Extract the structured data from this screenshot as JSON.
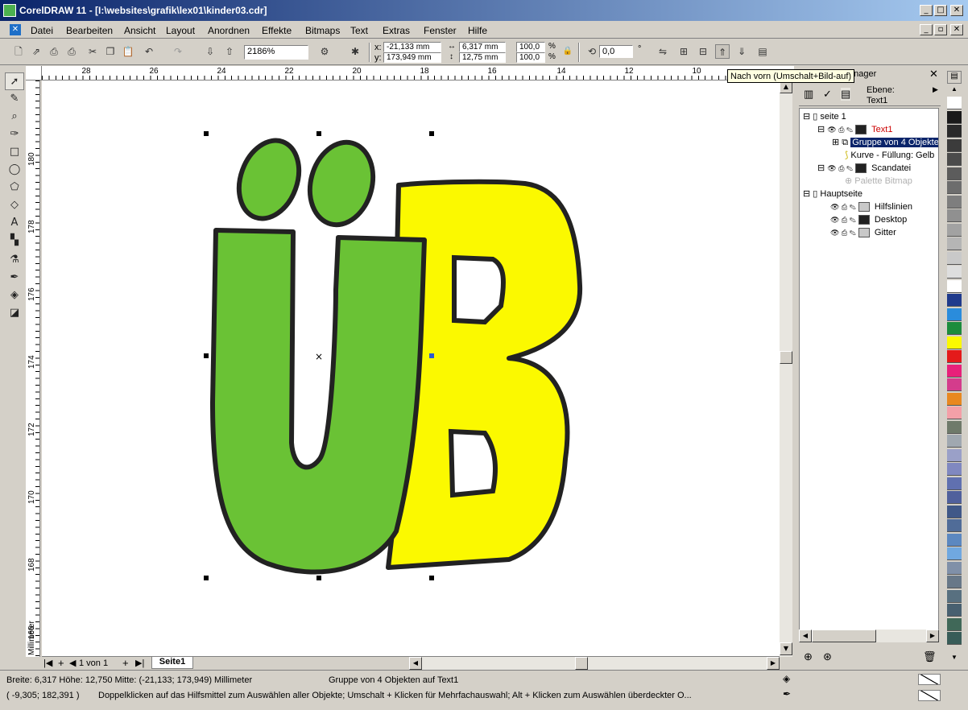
{
  "window": {
    "title": "CorelDRAW 11 - [I:\\websites\\grafik\\lex01\\kinder03.cdr]",
    "controls": [
      "_",
      "□",
      "✕"
    ],
    "doc_controls": [
      "_",
      "▫",
      "✕"
    ]
  },
  "menu": [
    "Datei",
    "Bearbeiten",
    "Ansicht",
    "Layout",
    "Anordnen",
    "Effekte",
    "Bitmaps",
    "Text",
    "Extras",
    "Fenster",
    "Hilfe"
  ],
  "toolbar": {
    "zoom": "2186%",
    "x_label": "x:",
    "y_label": "y:",
    "x_value": "-21,133 mm",
    "y_value": "173,949 mm",
    "width_value": "6,317 mm",
    "height_value": "12,75 mm",
    "scale_x": "100,0",
    "scale_y": "100,0",
    "percent": "%",
    "rotation": "0,0",
    "degree": "°"
  },
  "tooltip": "Nach vorn (Umschalt+Bild-auf)",
  "rulers": {
    "h_labels": [
      "28",
      "26",
      "24",
      "22",
      "20",
      "18",
      "16",
      "14",
      "12",
      "10"
    ],
    "v_labels": [
      "180",
      "178",
      "176",
      "174",
      "172",
      "170",
      "168",
      "166"
    ],
    "v_unit": "Millimeter"
  },
  "page_nav": {
    "count": "1 von 1",
    "tab": "Seite1"
  },
  "object_manager": {
    "title_tail": "anager",
    "layer_label": "Ebene:",
    "layer_value": "Text1",
    "tree": {
      "page1": "seite 1",
      "text1": "Text1",
      "group": "Gruppe von 4 Objekten",
      "curve": "Kurve - Füllung: Gelb",
      "scan": "Scandatei",
      "palette_bitmap": "Palette Bitmap",
      "master": "Hauptseite",
      "guides": "Hilfslinien",
      "desktop": "Desktop",
      "grid": "Gitter"
    },
    "colors": {
      "text1": "#cc0000",
      "selected_bg": "#0a246a"
    }
  },
  "status": {
    "dimensions": "Breite: 6,317  Höhe: 12,750  Mitte: (-21,133; 173,949) Millimeter",
    "selection": "Gruppe von 4 Objekten auf Text1",
    "cursor": "( -9,305; 182,391 )",
    "hint": "Doppelklicken auf das Hilfsmittel zum Auswählen aller Objekte; Umschalt + Klicken für Mehrfachauswahl; Alt + Klicken zum Auswählen überdeckter O..."
  },
  "artwork": {
    "green": "#6ac235",
    "yellow": "#fbf900",
    "outline": "#222222",
    "handle_center": "#2c5ccf"
  },
  "palette_colors": [
    "#ffffff",
    "#1a1a1a",
    "#2a2a2a",
    "#3b3b3b",
    "#4b4b4b",
    "#5c5c5c",
    "#6d6d6d",
    "#7e7e7e",
    "#909090",
    "#a2a2a2",
    "#b5b5b5",
    "#c9c9c9",
    "#dedede",
    "#ffffff",
    "#1f3a8c",
    "#2a8cdc",
    "#1c8c3c",
    "#fbf900",
    "#e41a1a",
    "#e8207a",
    "#d43c8c",
    "#e88820",
    "#f4a0a8",
    "#6f7a6a",
    "#a0a8b0",
    "#9aa0c8",
    "#8088c0",
    "#6070b0",
    "#50609c",
    "#405888",
    "#506c98",
    "#5c88c0",
    "#70a8e0",
    "#8090a8",
    "#687888",
    "#587080",
    "#486070",
    "#406858",
    "#385c58"
  ]
}
